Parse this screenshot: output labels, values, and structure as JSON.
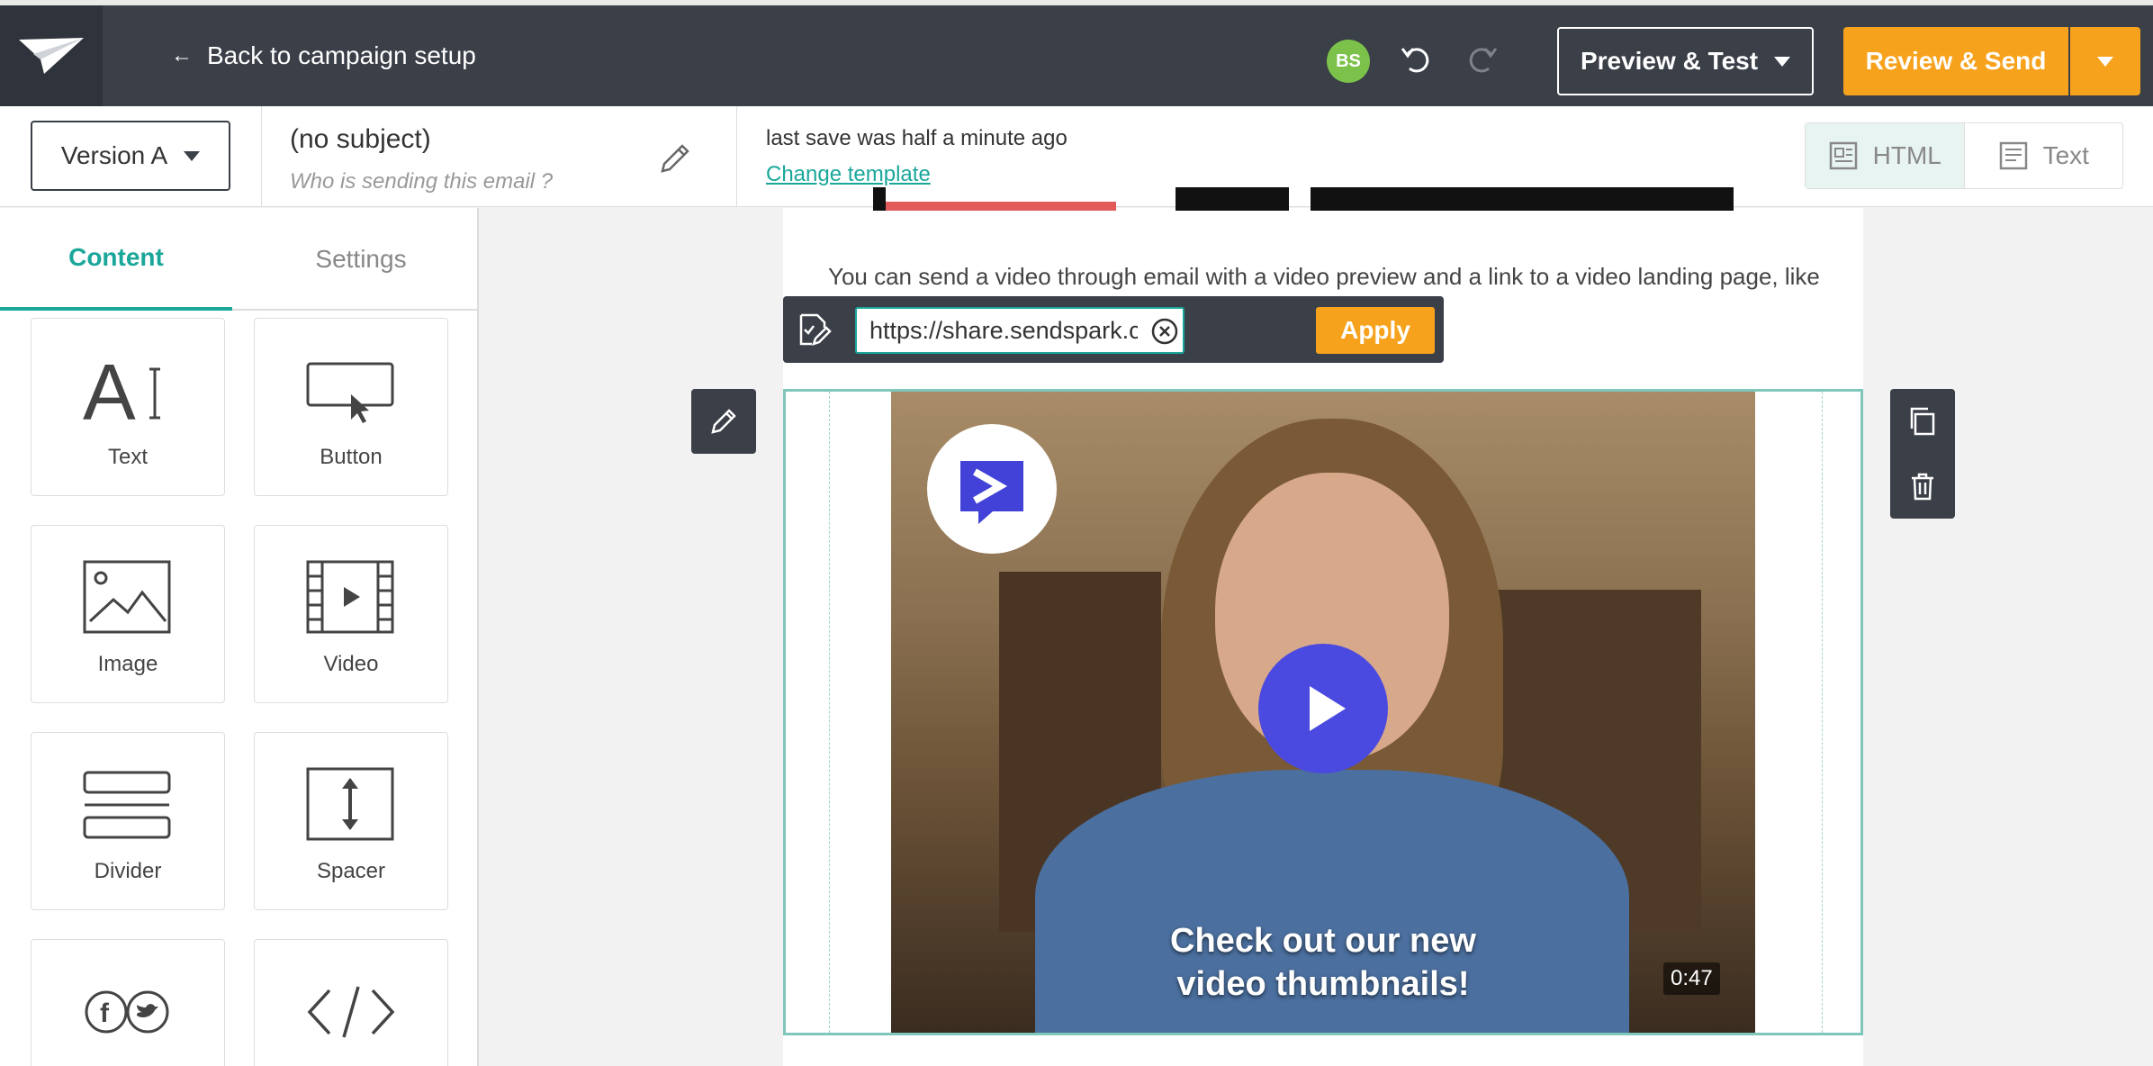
{
  "topbar": {
    "back_label": "Back to campaign setup",
    "avatar_initials": "BS",
    "avatar_color": "#7cc24a",
    "preview_label": "Preview & Test",
    "send_label": "Review & Send",
    "accent_color": "#f7a21c"
  },
  "subbar": {
    "version_label": "Version A",
    "subject": "(no subject)",
    "sender_placeholder": "Who is sending this email ?",
    "save_status": "last save was half a minute ago",
    "change_template_label": "Change template",
    "view_html_label": "HTML",
    "view_text_label": "Text"
  },
  "leftpanel": {
    "tabs": [
      {
        "label": "Content",
        "active": true
      },
      {
        "label": "Settings",
        "active": false
      }
    ],
    "tiles": [
      {
        "label": "Text",
        "icon": "text-icon"
      },
      {
        "label": "Button",
        "icon": "button-icon"
      },
      {
        "label": "Image",
        "icon": "image-icon"
      },
      {
        "label": "Video",
        "icon": "video-icon"
      },
      {
        "label": "Divider",
        "icon": "divider-icon"
      },
      {
        "label": "Spacer",
        "icon": "spacer-icon"
      },
      {
        "label": "",
        "icon": "social-icon"
      },
      {
        "label": "",
        "icon": "code-icon"
      }
    ]
  },
  "canvas": {
    "body_text": "You can send a video through email with a video preview and a link to a video landing page, like",
    "url_value": "https://share.sendspark.com/",
    "apply_label": "Apply",
    "video_caption": "Check out our new video thumbnails!",
    "video_duration": "0:47",
    "play_color": "#4a4ae0",
    "selection_color": "#7fc7bb"
  }
}
